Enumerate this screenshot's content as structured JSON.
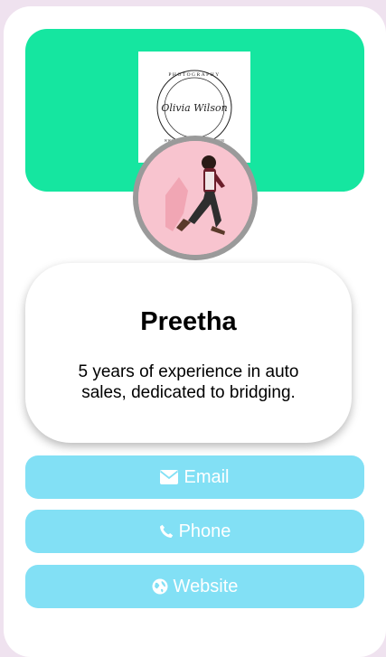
{
  "theme": {
    "banner_color": "#15e6a0",
    "button_color": "#82e0f5",
    "avatar_ring_color": "#9a9a9a"
  },
  "logo": {
    "lines": [
      "PHOTOGRAPHY",
      "Olivia Wilson",
      "WWW.REALLYGREATSITE.COM"
    ]
  },
  "profile": {
    "name": "Preetha",
    "bio": "5 years of experience in auto sales, dedicated to bridging."
  },
  "buttons": [
    {
      "label": "Email",
      "icon": "envelope-icon"
    },
    {
      "label": "Phone",
      "icon": "phone-icon"
    },
    {
      "label": "Website",
      "icon": "globe-icon"
    }
  ]
}
